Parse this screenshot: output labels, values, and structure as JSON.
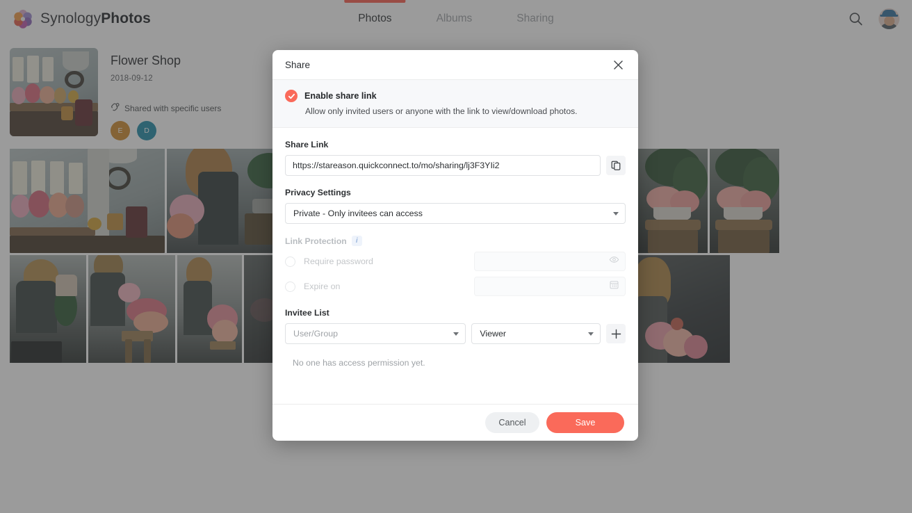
{
  "app": {
    "brand_thin": "Synology",
    "brand_bold": "Photos",
    "logo_icon": "synology-flower-logo"
  },
  "header": {
    "nav": [
      {
        "label": "Photos",
        "active": true
      },
      {
        "label": "Albums",
        "active": false
      },
      {
        "label": "Sharing",
        "active": false
      }
    ],
    "search_icon": "search-icon",
    "avatar_icon": "user-avatar",
    "active_indicator_color": "#fa5a4b"
  },
  "album": {
    "title": "Flower Shop",
    "date": "2018-09-12",
    "shared_icon": "shared-link-icon",
    "shared_label": "Shared with specific users",
    "members": [
      {
        "initial": "E",
        "color": "#cf8b2c"
      },
      {
        "initial": "D",
        "color": "#1e8aa8"
      }
    ]
  },
  "dialog": {
    "title": "Share",
    "close_icon": "close-icon",
    "enable": {
      "checked": true,
      "check_icon": "check-circle-icon",
      "title": "Enable share link",
      "description": "Allow only invited users or anyone with the link to view/download photos.",
      "accent_color": "#fa6a5a"
    },
    "share_link": {
      "label": "Share Link",
      "value": "https://stareason.quickconnect.to/mo/sharing/lj3F3YIi2",
      "copy_icon": "copy-icon"
    },
    "privacy": {
      "label": "Privacy Settings",
      "selected": "Private - Only invitees can access",
      "caret_icon": "chevron-down-icon"
    },
    "link_protection": {
      "label": "Link Protection",
      "info_icon": "info-icon",
      "disabled": true,
      "rows": [
        {
          "label": "Require password",
          "value": "",
          "right_icon": "eye-icon"
        },
        {
          "label": "Expire on",
          "value": "",
          "right_icon": "calendar-icon"
        }
      ]
    },
    "invitee": {
      "label": "Invitee List",
      "user_placeholder": "User/Group",
      "role_selected": "Viewer",
      "add_icon": "plus-icon",
      "empty_message": "No one has access permission yet."
    },
    "footer": {
      "cancel_label": "Cancel",
      "save_label": "Save",
      "save_color": "#fa6a5a",
      "cancel_color": "#eef0f2"
    }
  }
}
